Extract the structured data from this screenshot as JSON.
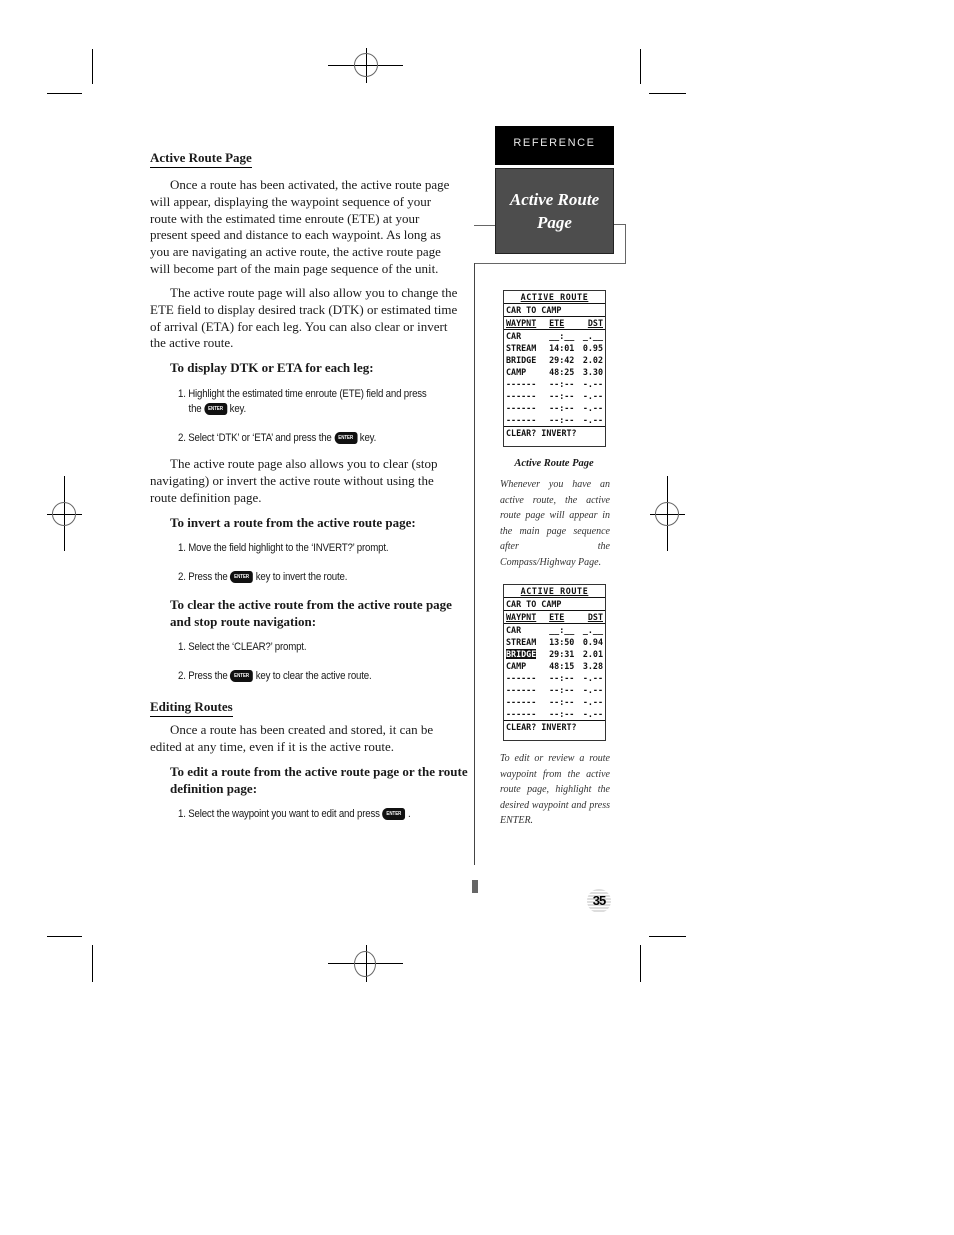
{
  "sidebar": {
    "tab_label": "REFERENCE",
    "section_title_line1": "Active Route",
    "section_title_line2": "Page"
  },
  "main": {
    "section1": {
      "heading": "Active Route Page",
      "para1": "Once a route has been activated, the active route page will appear, displaying the waypoint sequence of your route with the estimated time enroute (ETE) at your present speed and distance to each waypoint. As long as you are navigating an active route, the active route page will become part of the main page sequence of the unit.",
      "para2": "The active route page will also allow you to change the ETE field to display desired track (DTK) or estimated time of arrival (ETA) for each leg. You can also clear or invert the active route.",
      "sub1": "To display DTK or ETA for each leg:",
      "sub1_step1a": "1. Highlight the estimated time enroute (ETE) field and press",
      "sub1_step1b": "the",
      "sub1_step1c": "key.",
      "sub1_step2a": "2. Select ‘DTK’ or ‘ETA’ and press the",
      "sub1_step2b": "key.",
      "para3": "The active route page also allows you to clear (stop navigating) or invert the active route without using the route definition page.",
      "sub2": "To invert a route from the active route page:",
      "sub2_step1": "1. Move the field highlight to the ‘INVERT?’ prompt.",
      "sub2_step2a": "2. Press the",
      "sub2_step2b": "key to invert the route.",
      "sub3": "To clear the active route from the active route page and stop route navigation:",
      "sub3_step1": "1. Select the ‘CLEAR?’ prompt.",
      "sub3_step2a": "2. Press the",
      "sub3_step2b": "key to clear the active route."
    },
    "section2": {
      "heading": "Editing Routes",
      "para1": "Once a route has been created and stored, it can be edited at any time, even if it is the active route.",
      "sub1": "To edit a route from the active route page or the route definition page:",
      "step1a": "1. Select the waypoint you want to edit and press",
      "step1b": "."
    },
    "enter_key_label": "ENTER"
  },
  "screens": [
    {
      "title": "ACTIVE ROUTE",
      "route": "CAR TO CAMP",
      "headers": [
        "WAYPNT",
        "ETE",
        "DST"
      ],
      "rows": [
        [
          "CAR",
          "__:__",
          "_.__"
        ],
        [
          "STREAM",
          "14:01",
          "0.95"
        ],
        [
          "BRIDGE",
          "29:42",
          "2.02"
        ],
        [
          "CAMP",
          "48:25",
          "3.30"
        ],
        [
          "------",
          "--:--",
          "-.--"
        ],
        [
          "------",
          "--:--",
          "-.--"
        ],
        [
          "------",
          "--:--",
          "-.--"
        ],
        [
          "------",
          "--:--",
          "-.--"
        ]
      ],
      "footer": "CLEAR? INVERT?",
      "highlighted_row": null
    },
    {
      "title": "ACTIVE ROUTE",
      "route": "CAR TO CAMP",
      "headers": [
        "WAYPNT",
        "ETE",
        "DST"
      ],
      "rows": [
        [
          "CAR",
          "__:__",
          "_.__"
        ],
        [
          "STREAM",
          "13:50",
          "0.94"
        ],
        [
          "BRIDGE",
          "29:31",
          "2.01"
        ],
        [
          "CAMP",
          "48:15",
          "3.28"
        ],
        [
          "------",
          "--:--",
          "-.--"
        ],
        [
          "------",
          "--:--",
          "-.--"
        ],
        [
          "------",
          "--:--",
          "-.--"
        ],
        [
          "------",
          "--:--",
          "-.--"
        ]
      ],
      "footer": "CLEAR? INVERT?",
      "highlighted_row": 2
    }
  ],
  "captions": {
    "caption1_title": "Active Route Page",
    "caption1_text": "Whenever you have an active route, the active route page will appear in the main page sequence after the Compass/Highway Page.",
    "caption2_text": "To edit or review a route waypoint from the active route page, highlight the desired waypoint and press ENTER."
  },
  "page_number": "35"
}
